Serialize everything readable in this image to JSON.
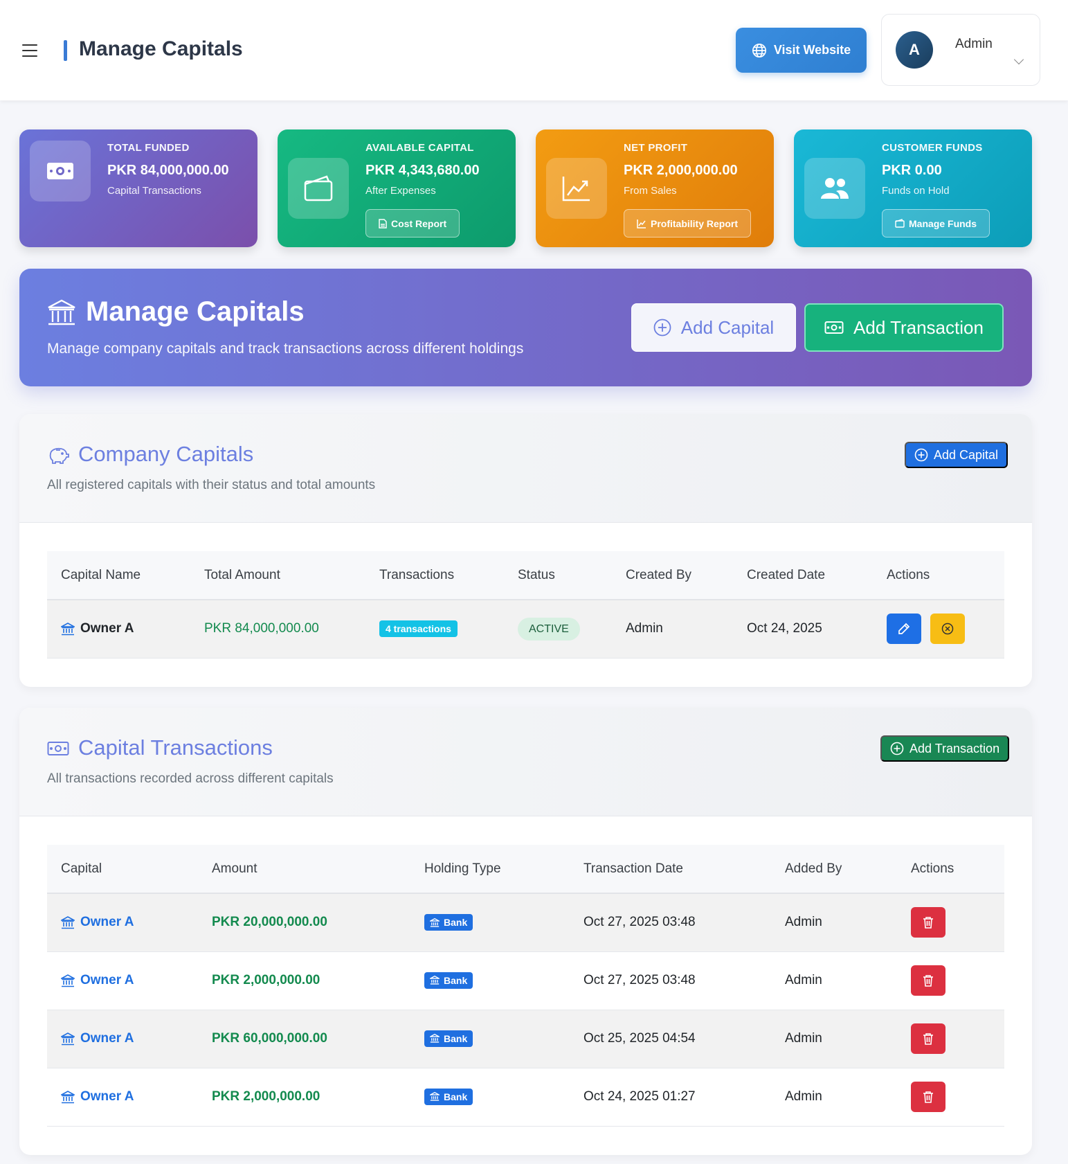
{
  "header": {
    "title": "Manage Capitals",
    "visit_website": "Visit Website",
    "user": {
      "initial": "A",
      "name": "Admin"
    }
  },
  "stats": [
    {
      "label": "TOTAL FUNDED",
      "value": "PKR 84,000,000.00",
      "sub": "Capital Transactions",
      "button": "",
      "icon": "cash-icon"
    },
    {
      "label": "AVAILABLE CAPITAL",
      "value": "PKR 4,343,680.00",
      "sub": "After Expenses",
      "button": "Cost Report",
      "icon": "wallet-icon"
    },
    {
      "label": "NET PROFIT",
      "value": "PKR 2,000,000.00",
      "sub": "From Sales",
      "button": "Profitability Report",
      "icon": "chart-line-icon"
    },
    {
      "label": "CUSTOMER FUNDS",
      "value": "PKR 0.00",
      "sub": "Funds on Hold",
      "button": "Manage Funds",
      "icon": "users-icon"
    }
  ],
  "hero": {
    "title": "Manage Capitals",
    "subtitle": "Manage company capitals and track transactions across different holdings",
    "add_capital": "Add Capital",
    "add_transaction": "Add Transaction"
  },
  "capitals": {
    "title": "Company Capitals",
    "subtitle": "All registered capitals with their status and total amounts",
    "button": "Add Capital",
    "columns": [
      "Capital Name",
      "Total Amount",
      "Transactions",
      "Status",
      "Created By",
      "Created Date",
      "Actions"
    ],
    "rows": [
      {
        "name": "Owner A",
        "amount": "PKR 84,000,000.00",
        "transactions": "4 transactions",
        "status": "ACTIVE",
        "created_by": "Admin",
        "created_date": "Oct 24, 2025"
      }
    ]
  },
  "transactions": {
    "title": "Capital Transactions",
    "subtitle": "All transactions recorded across different capitals",
    "button": "Add Transaction",
    "columns": [
      "Capital",
      "Amount",
      "Holding Type",
      "Transaction Date",
      "Added By",
      "Actions"
    ],
    "rows": [
      {
        "capital": "Owner A",
        "amount": "PKR 20,000,000.00",
        "holding": "Bank",
        "date": "Oct 27, 2025 03:48",
        "added_by": "Admin"
      },
      {
        "capital": "Owner A",
        "amount": "PKR 2,000,000.00",
        "holding": "Bank",
        "date": "Oct 27, 2025 03:48",
        "added_by": "Admin"
      },
      {
        "capital": "Owner A",
        "amount": "PKR 60,000,000.00",
        "holding": "Bank",
        "date": "Oct 25, 2025 04:54",
        "added_by": "Admin"
      },
      {
        "capital": "Owner A",
        "amount": "PKR 2,000,000.00",
        "holding": "Bank",
        "date": "Oct 24, 2025 01:27",
        "added_by": "Admin"
      }
    ]
  },
  "colors": {
    "primary": "#6c7fe0",
    "success": "#17b27d",
    "danger": "#dc3040",
    "warning": "#f7bd14",
    "link": "#1f6fe0"
  }
}
